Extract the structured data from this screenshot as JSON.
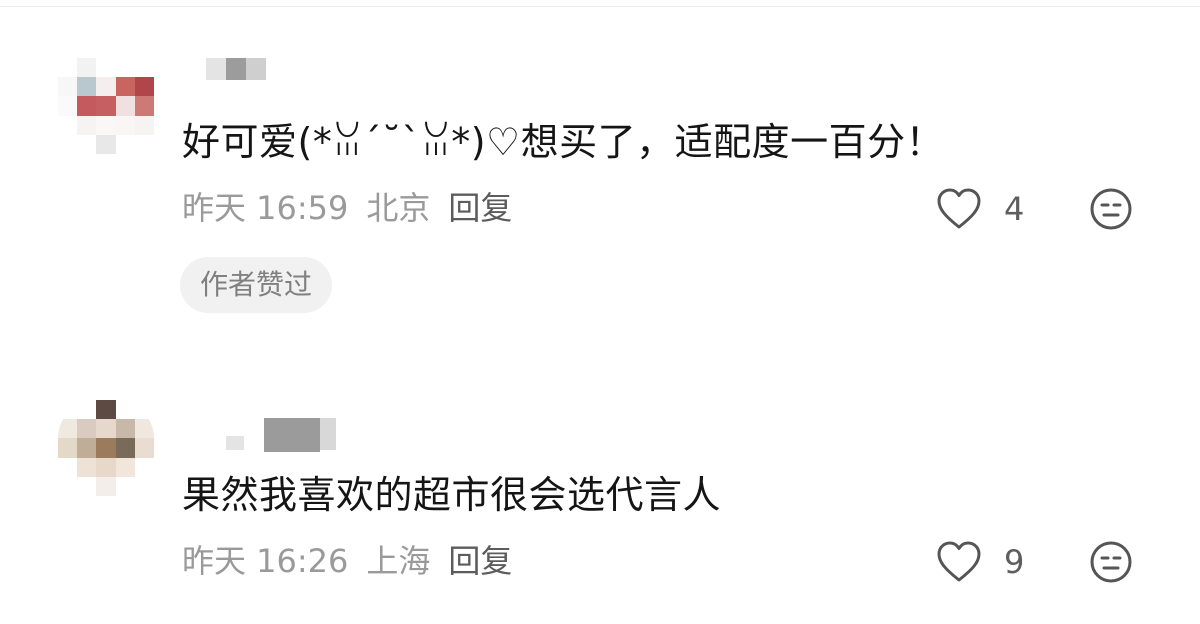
{
  "comments": [
    {
      "text": "好可爱(*ꈍ´˘`ꈍ*)♡想买了，适配度一百分！",
      "time": "昨天 16:59",
      "location": "北京",
      "reply_label": "回复",
      "like_count": "4",
      "badge": "作者赞过"
    },
    {
      "text": "果然我喜欢的超市很会选代言人",
      "time": "昨天 16:26",
      "location": "上海",
      "reply_label": "回复",
      "like_count": "9"
    }
  ],
  "icons": {
    "like": "heart-outline-icon",
    "emoji": "neutral-face-icon"
  },
  "colors": {
    "text": "#151515",
    "meta": "#9a9a9a",
    "badge_bg": "#f1f1f1"
  }
}
